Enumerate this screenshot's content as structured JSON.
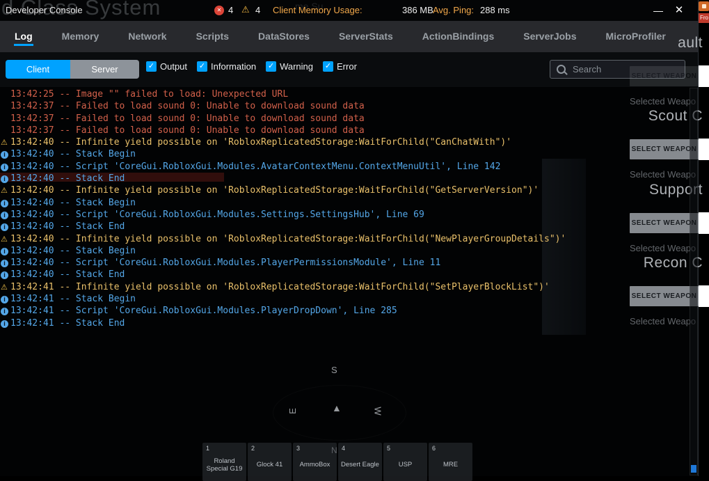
{
  "titlebar": {
    "title": "Developer Console",
    "error_count": "4",
    "warning_count": "4",
    "memory_label": "Client Memory Usage:",
    "memory_value": "386 MB",
    "ping_label": "Avg. Ping:",
    "ping_value": "288 ms"
  },
  "tabs": {
    "active": "Log",
    "items": [
      "Log",
      "Memory",
      "Network",
      "Scripts",
      "DataStores",
      "ServerStats",
      "ActionBindings",
      "ServerJobs",
      "MicroProfiler"
    ]
  },
  "filterbar": {
    "client": "Client",
    "server": "Server",
    "checkboxes": [
      "Output",
      "Information",
      "Warning",
      "Error"
    ],
    "search_placeholder": "Search"
  },
  "log": {
    "lines": [
      {
        "type": "error",
        "time": "13:42:25",
        "message": "Image \"\" failed to load: Unexpected URL"
      },
      {
        "type": "error",
        "time": "13:42:37",
        "message": "Failed to load sound 0: Unable to download sound data"
      },
      {
        "type": "error",
        "time": "13:42:37",
        "message": "Failed to load sound 0: Unable to download sound data"
      },
      {
        "type": "error",
        "time": "13:42:37",
        "message": "Failed to load sound 0: Unable to download sound data"
      },
      {
        "type": "warning",
        "time": "13:42:40",
        "message": "Infinite yield possible on 'RobloxReplicatedStorage:WaitForChild(\"CanChatWith\")'"
      },
      {
        "type": "info",
        "time": "13:42:40",
        "message": "Stack Begin"
      },
      {
        "type": "info",
        "time": "13:42:40",
        "message": "Script 'CoreGui.RobloxGui.Modules.AvatarContextMenu.ContextMenuUtil', Line 142"
      },
      {
        "type": "info",
        "time": "13:42:40",
        "message": "Stack End"
      },
      {
        "type": "warning",
        "time": "13:42:40",
        "message": "Infinite yield possible on 'RobloxReplicatedStorage:WaitForChild(\"GetServerVersion\")'"
      },
      {
        "type": "info",
        "time": "13:42:40",
        "message": "Stack Begin"
      },
      {
        "type": "info",
        "time": "13:42:40",
        "message": "Script 'CoreGui.RobloxGui.Modules.Settings.SettingsHub', Line 69"
      },
      {
        "type": "info",
        "time": "13:42:40",
        "message": "Stack End"
      },
      {
        "type": "warning",
        "time": "13:42:40",
        "message": "Infinite yield possible on 'RobloxReplicatedStorage:WaitForChild(\"NewPlayerGroupDetails\")'"
      },
      {
        "type": "info",
        "time": "13:42:40",
        "message": "Stack Begin"
      },
      {
        "type": "info",
        "time": "13:42:40",
        "message": "Script 'CoreGui.RobloxGui.Modules.PlayerPermissionsModule', Line 11"
      },
      {
        "type": "info",
        "time": "13:42:40",
        "message": "Stack End"
      },
      {
        "type": "warning",
        "time": "13:42:41",
        "message": "Infinite yield possible on 'RobloxReplicatedStorage:WaitForChild(\"SetPlayerBlockList\")'"
      },
      {
        "type": "info",
        "time": "13:42:41",
        "message": "Stack Begin"
      },
      {
        "type": "info",
        "time": "13:42:41",
        "message": "Script 'CoreGui.RobloxGui.Modules.PlayerDropDown', Line 285"
      },
      {
        "type": "info",
        "time": "13:42:41",
        "message": "Stack End"
      }
    ]
  },
  "game": {
    "background_title": "d Class System",
    "background_text_fragment": "me Su",
    "corner_badge": "Fro",
    "weapon_panel": {
      "sections": [
        {
          "class_name": "ault",
          "button_label": "SELECT WEAPON",
          "selected_label": "Selected Weapo"
        },
        {
          "class_name": "Scout C",
          "button_label": "SELECT WEAPON",
          "selected_label": "Selected Weapo"
        },
        {
          "class_name": "Support",
          "button_label": "SELECT WEAPON",
          "selected_label": "Selected Weapo"
        },
        {
          "class_name": "Recon C",
          "button_label": "SELECT WEAPON",
          "selected_label": "Selected Weapo"
        }
      ]
    },
    "compass": {
      "north": "N",
      "south": "S",
      "east": "E",
      "west": "W"
    },
    "hotbar": [
      {
        "key": "1",
        "name": "Roland Special G19"
      },
      {
        "key": "2",
        "name": "Glock 41"
      },
      {
        "key": "3",
        "name": "AmmoBox"
      },
      {
        "key": "4",
        "name": "Desert Eagle"
      },
      {
        "key": "5",
        "name": "USP"
      },
      {
        "key": "6",
        "name": "MRE"
      }
    ]
  },
  "colors": {
    "accent": "#00a2ff",
    "error_text": "#d2604a",
    "warning_text": "#e9c06a",
    "info_text": "#54a7e8"
  }
}
